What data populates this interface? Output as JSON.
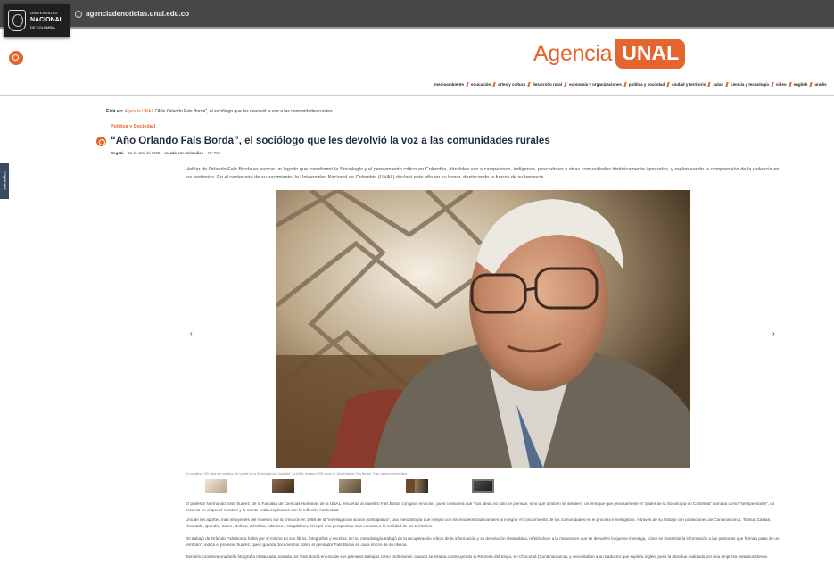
{
  "topbar": {
    "logo": {
      "line1": "UNIVERSIDAD",
      "line2": "NACIONAL",
      "line3": "DE COLOMBIA"
    },
    "url": "agenciadenoticias.unal.edu.co"
  },
  "brand": {
    "word": "Agencia",
    "box": "UNAL"
  },
  "nav": {
    "items": [
      "medioambiente",
      "educación",
      "artes y cultura",
      "desarrollo rural",
      "economía y organizaciones",
      "política y sociedad",
      "ciudad y territorio",
      "salud",
      "ciencia y tecnología",
      "video",
      "english",
      "unidiv"
    ]
  },
  "breadcrumb": {
    "prefix": "Está en:",
    "link": "Agencia UNAL",
    "current": "/“Año Orlando Fals Borda”, el sociólogo que les devolvió la voz a las comunidades rurales"
  },
  "side_tab": "unimedios",
  "article": {
    "section": "Política y Sociedad",
    "title": "“Año Orlando Fals Borda”, el sociólogo que les devolvió la voz a las comunidades rurales",
    "meta": {
      "city": "Bogotá",
      "date": "21 de abril de 2025",
      "creator": "creado por unimedios",
      "number": "N.º 752"
    },
    "lead": "Hablar de Orlando Fals Borda es evocar un legado que transformó la Sociología y el pensamiento crítico en Colombia, dándoles voz a campesinos, indígenas, pescadores y otras comunidades históricamente ignoradas, y replanteando la comprensión de la violencia en los territorios. En el centenario de su nacimiento, la Universidad Nacional de Colombia (UNAL) declaró este año en su honor, destacando la fuerza de su herencia.",
    "caption": "Al cumplirse 100 años del natalicio del “padre de la Sociología en Colombia”, la UNAL declaró 2025 como el “Año Orlando Fals Borda”. Foto: archivo Unimedios.",
    "prev": "‹",
    "next": "›",
    "paragraphs": [
      "El profesor Normando José Suárez, de la Facultad de Ciencias Humanas de la UNAL, recuerda al maestro Fals Borda con gran emoción, pues considera que “sus ideas no solo se piensan, sino que también se sienten”, un enfoque que precisamente el “padre de la Sociología en Colombia” llamaba como “sentipensante”, un proceso en el que el corazón y la mente están implicados con la reflexión intelectual.",
      "Uno de los aportes más influyentes del maestro fue la creación en 1958 de la “investigación acción participativa”, una metodología que rompió con los modelos tradicionales al integrar el conocimiento de las comunidades en el proceso investigativo. A través de su trabajo con poblaciones de Cundinamarca, Tolima, Caldas, Risaralda, Quindío, Sucre, Bolívar, Córdoba, Atlántico y Magdalena, él logró una perspectiva más cercana a la realidad de los territorios.",
      "“El trabajo de Orlando Fals Borda habla por sí mismo en sus libros, fotografías y escritos. En su metodología trabajó de la recuperación crítica de la información y su devolución sistemática, refiriéndose a la manera en que se devuelve lo que se investiga, cómo se transmite la información a las personas que forman parte de un territorio”, indica el profesor Suárez, quien guarda documentos sobre el pensador Fals Borda en cada rincón de su oficina.",
      "También conserva una bella fotografía restaurada, tomada por Fals Borda en uno de sus primeros trabajos como profesional, cuando se estaba construyendo la Represa del Sisga, en Chocontá (Cundinamarca), y necesitaban a un traductor que supiera inglés, pues la obra fue realizada por una empresa estadounidense."
    ]
  },
  "colors": {
    "accent": "#e5652e",
    "topbar": "#474747",
    "title": "#1f2d3d"
  }
}
